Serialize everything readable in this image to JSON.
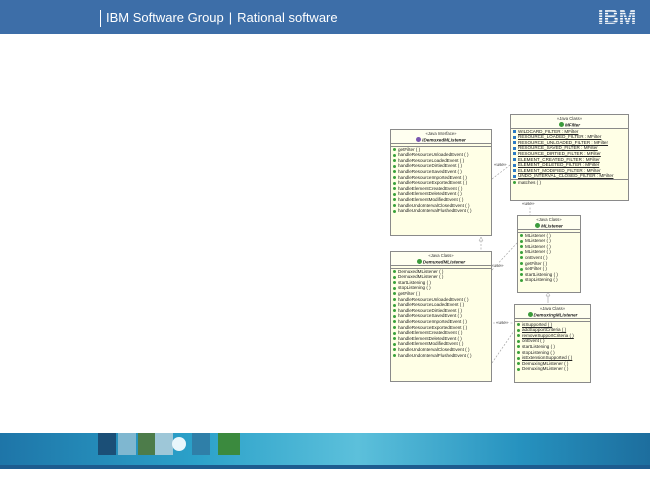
{
  "header": {
    "group": "IBM Software Group",
    "separator": "|",
    "product": "Rational software",
    "logo_text": "IBM"
  },
  "colors": {
    "header_bg": "#3d6ea8",
    "class_fill": "#ffffe6",
    "footer_band": "#2ba1c9"
  },
  "diagram": {
    "filter": {
      "stereotype": "«Java Class»",
      "name": "MFilter",
      "fields": [
        "WILDCARD_FILTER : MFilter",
        "RESOURCE_LOADED_FILTER : MFilter",
        "RESOURCE_UNLOADED_FILTER : MFilter",
        "RESOURCE_SAVED_FILTER : MFilter",
        "RESOURCE_DIRTIED_FILTER : MFilter",
        "ELEMENT_CREATED_FILTER : MFilter",
        "ELEMENT_DELETED_FILTER : MFilter",
        "ELEMENT_MODIFIED_FILTER : MFilter",
        "UNDO_INTERVAL_CLOSED_FILTER : MFilter"
      ],
      "methods": [
        "matches ( )"
      ]
    },
    "interface": {
      "stereotype": "«Java Interface»",
      "name": "IDemuxedMListener",
      "methods": [
        "getFilter ( )",
        "handleResourceUnloadedEvent ( )",
        "handleResourceLoadedEvent ( )",
        "handleResourceDirtiedEvent ( )",
        "handleResourceSavedEvent ( )",
        "handleResourceImportedEvent ( )",
        "handleResourceExportedEvent ( )",
        "handleElementCreatedEvent ( )",
        "handleElementDeletedEvent ( )",
        "handleElementModifiedEvent ( )",
        "handleUndoIntervalClosedEvent ( )",
        "handleUndoIntervalFlushedEvent ( )"
      ]
    },
    "mlistener": {
      "stereotype": "«Java Class»",
      "name": "MListener",
      "methods": [
        "MListener ( )",
        "MListener ( )",
        "MListener ( )",
        "MListener ( )",
        "onEvent ( )",
        "getFilter ( )",
        "setFilter ( )",
        "startListening ( )",
        "stopListening ( )"
      ]
    },
    "demuxed": {
      "stereotype": "«Java Class»",
      "name": "DemuxedMListener",
      "methods": [
        "DemuxedMListener ( )",
        "DemuxedMListener ( )",
        "startListening ( )",
        "stopListening ( )",
        "getFilter ( )",
        "handleResourceUnloadedEvent ( )",
        "handleResourceLoadedEvent ( )",
        "handleResourceDirtiedEvent ( )",
        "handleResourceSavedEvent ( )",
        "handleResourceImportedEvent ( )",
        "handleResourceExportedEvent ( )",
        "handleElementCreatedEvent ( )",
        "handleElementDeletedEvent ( )",
        "handleElementModifiedEvent ( )",
        "handleUndoIntervalClosedEvent ( )",
        "handleUndoIntervalFlushedEvent ( )"
      ]
    },
    "demuxing": {
      "stereotype": "«Java Class»",
      "name": "DemuxingMListener",
      "methods": [
        "isSupported ( )",
        "addSupportCriteria ( )",
        "removeSupportCriteria ( )",
        "onEvent ( )",
        "startListening ( )",
        "stopListening ( )",
        "isExtensionSupported ( )",
        "DemuxingMListener ( )",
        "DemuxingMListener ( )"
      ],
      "underlined": [
        0,
        1,
        2,
        6
      ]
    },
    "edge_labels": [
      "«use»",
      "«use»",
      "«use»",
      "«use»"
    ]
  }
}
